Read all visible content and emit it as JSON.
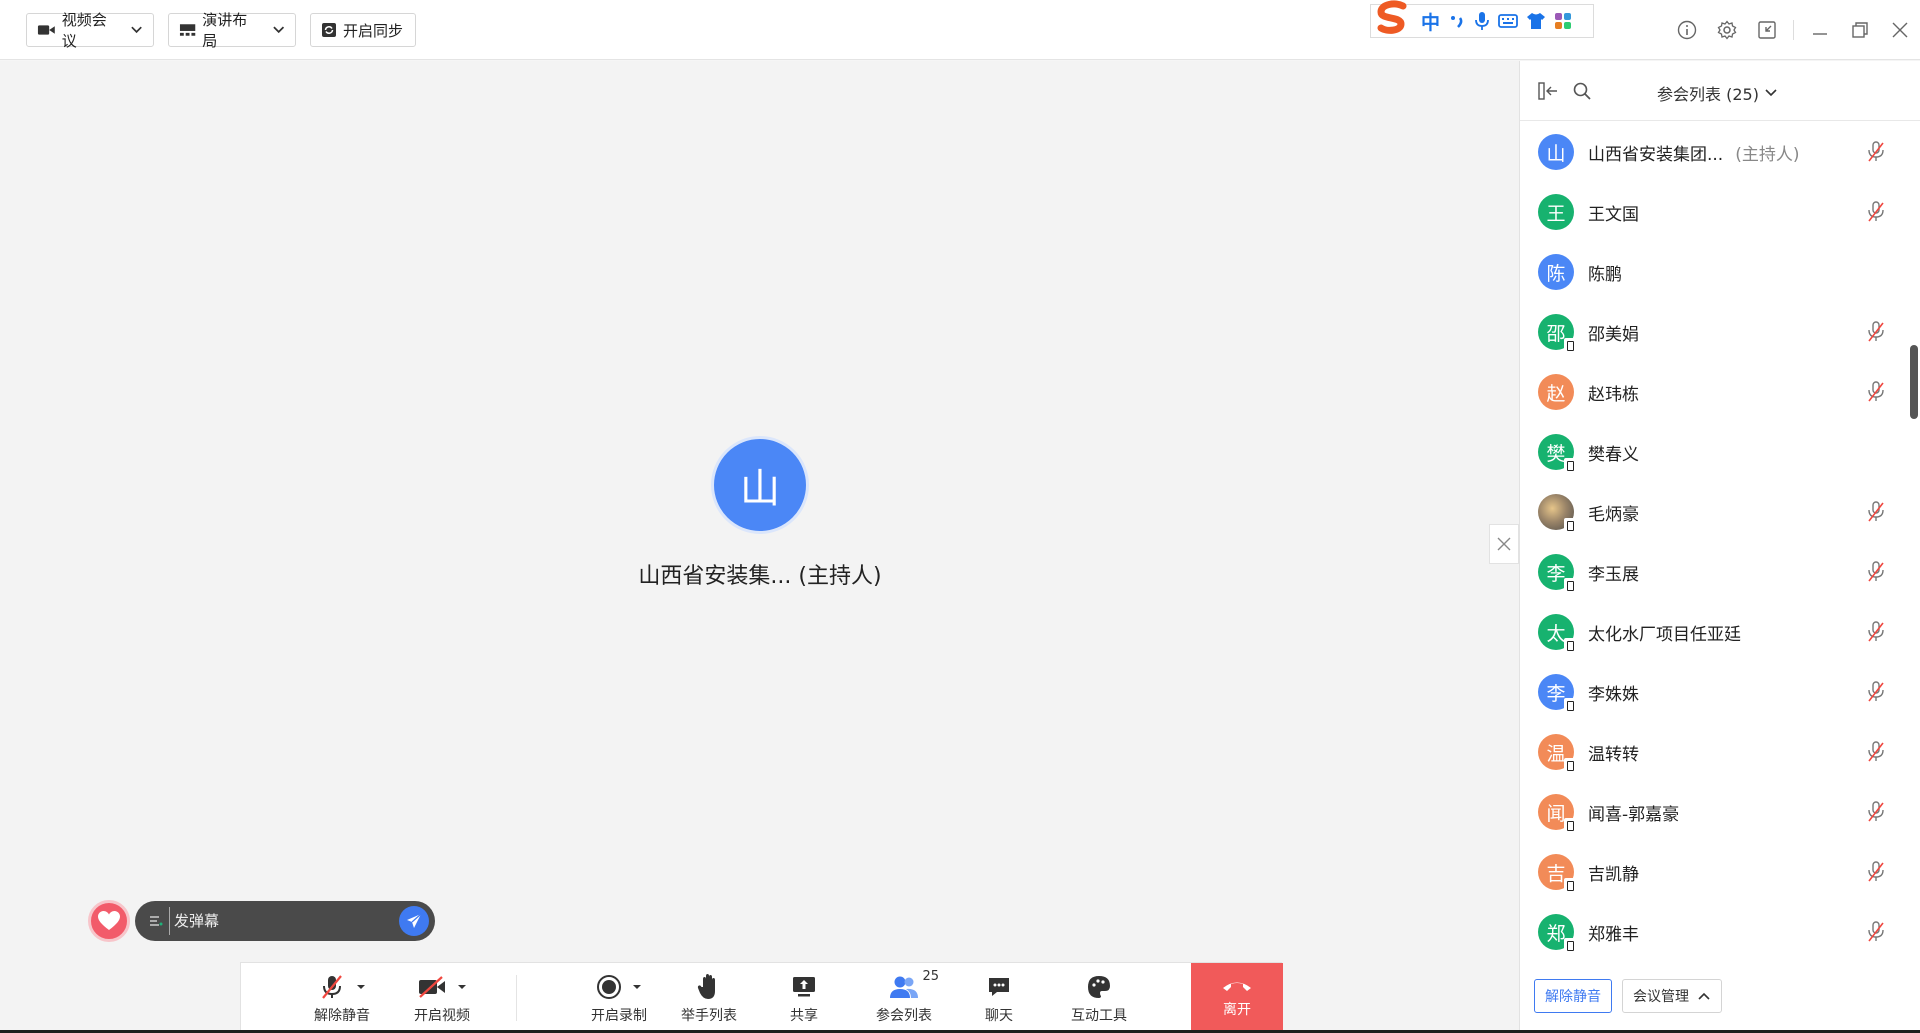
{
  "topbar": {
    "mode_label": "视频会议",
    "layout_label": "演讲布局",
    "sync_label": "开启同步",
    "ime_lang": "中"
  },
  "stage": {
    "avatar_char": "山",
    "speaker_name": "山西省安装集... (主持人)"
  },
  "danmaku": {
    "placeholder": "发弹幕"
  },
  "toolbar": {
    "unmute": "解除静音",
    "start_video": "开启视频",
    "record": "开启录制",
    "raise_hand": "举手列表",
    "share": "共享",
    "participants": "参会列表",
    "participants_count": "25",
    "chat": "聊天",
    "interactive": "互动工具",
    "leave": "离开"
  },
  "sidebar": {
    "title": "参会列表 (25)",
    "participants": [
      {
        "avatar": "山",
        "name": "山西省安装集团...",
        "role": "(主持人)",
        "color": "blue",
        "mobile": false,
        "muted": true
      },
      {
        "avatar": "王",
        "name": "王文国",
        "role": "",
        "color": "green",
        "mobile": false,
        "muted": true
      },
      {
        "avatar": "陈",
        "name": "陈鹏",
        "role": "",
        "color": "blue",
        "mobile": false,
        "muted": false
      },
      {
        "avatar": "邵",
        "name": "邵美娟",
        "role": "",
        "color": "green",
        "mobile": true,
        "muted": true
      },
      {
        "avatar": "赵",
        "name": "赵玮栋",
        "role": "",
        "color": "orange",
        "mobile": false,
        "muted": true
      },
      {
        "avatar": "樊",
        "name": "樊春义",
        "role": "",
        "color": "green",
        "mobile": true,
        "muted": false
      },
      {
        "avatar": "",
        "name": "毛炳豪",
        "role": "",
        "color": "photo",
        "mobile": true,
        "muted": true
      },
      {
        "avatar": "李",
        "name": "李玉展",
        "role": "",
        "color": "green",
        "mobile": true,
        "muted": true
      },
      {
        "avatar": "太",
        "name": "太化水厂项目任亚廷",
        "role": "",
        "color": "green",
        "mobile": true,
        "muted": true
      },
      {
        "avatar": "李",
        "name": "李姝姝",
        "role": "",
        "color": "blue",
        "mobile": true,
        "muted": true
      },
      {
        "avatar": "温",
        "name": "温转转",
        "role": "",
        "color": "orange",
        "mobile": true,
        "muted": true
      },
      {
        "avatar": "闻",
        "name": "闻喜-郭嘉豪",
        "role": "",
        "color": "orange",
        "mobile": true,
        "muted": true
      },
      {
        "avatar": "吉",
        "name": "吉凯静",
        "role": "",
        "color": "orange",
        "mobile": true,
        "muted": true
      },
      {
        "avatar": "郑",
        "name": "郑雅丰",
        "role": "",
        "color": "green",
        "mobile": true,
        "muted": true
      }
    ],
    "unmute_all": "解除静音",
    "manage": "会议管理"
  }
}
